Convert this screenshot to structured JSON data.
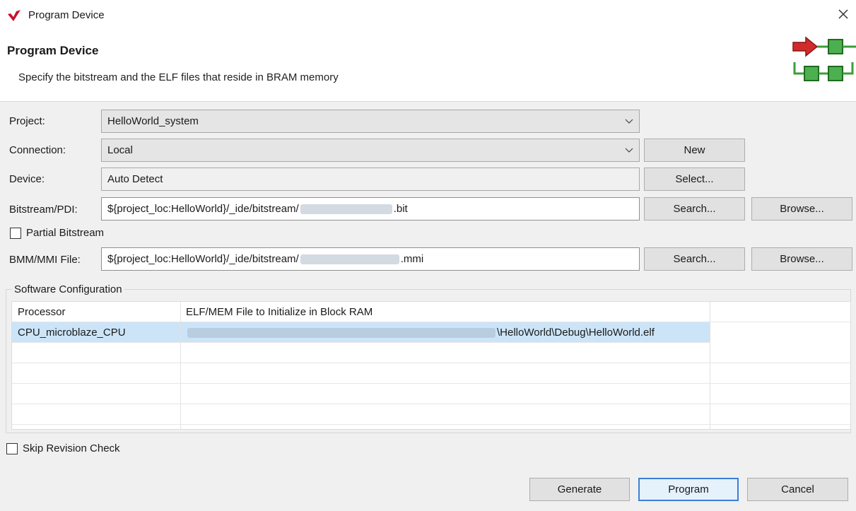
{
  "window": {
    "title": "Program Device",
    "logo_icon": "vitis-logo-icon",
    "close_icon": "close-icon"
  },
  "header": {
    "title": "Program Device",
    "description": "Specify the bitstream and the ELF files that reside in BRAM memory",
    "graphic_icon": "program-device-graphic-icon"
  },
  "form": {
    "project": {
      "label": "Project:",
      "value": "HelloWorld_system"
    },
    "connection": {
      "label": "Connection:",
      "value": "Local",
      "new_label": "New"
    },
    "device": {
      "label": "Device:",
      "value": "Auto Detect",
      "select_label": "Select..."
    },
    "bitstream": {
      "label": "Bitstream/PDI:",
      "value_prefix": "${project_loc:HelloWorld}/_ide/bitstream/",
      "value_suffix": ".bit",
      "search_label": "Search...",
      "browse_label": "Browse..."
    },
    "partial_bitstream": {
      "label": "Partial Bitstream",
      "checked": false
    },
    "bmm": {
      "label": "BMM/MMI File:",
      "value_prefix": "${project_loc:HelloWorld}/_ide/bitstream/",
      "value_suffix": ".mmi",
      "search_label": "Search...",
      "browse_label": "Browse..."
    }
  },
  "software_configuration": {
    "group_label": "Software Configuration",
    "columns": [
      "Processor",
      "ELF/MEM File to Initialize in Block RAM"
    ],
    "rows": [
      {
        "processor": "CPU_microblaze_CPU",
        "elf_suffix": "\\HelloWorld\\Debug\\HelloWorld.elf",
        "selected": true
      }
    ]
  },
  "skip_revision": {
    "label": "Skip Revision Check",
    "checked": false
  },
  "footer": {
    "generate_label": "Generate",
    "program_label": "Program",
    "cancel_label": "Cancel"
  },
  "colors": {
    "accent": "#3b7fd6",
    "selection": "#cce4f7",
    "logo_red": "#c8102e",
    "graphic_green": "#3a9e3a",
    "graphic_red": "#d22b2b"
  }
}
